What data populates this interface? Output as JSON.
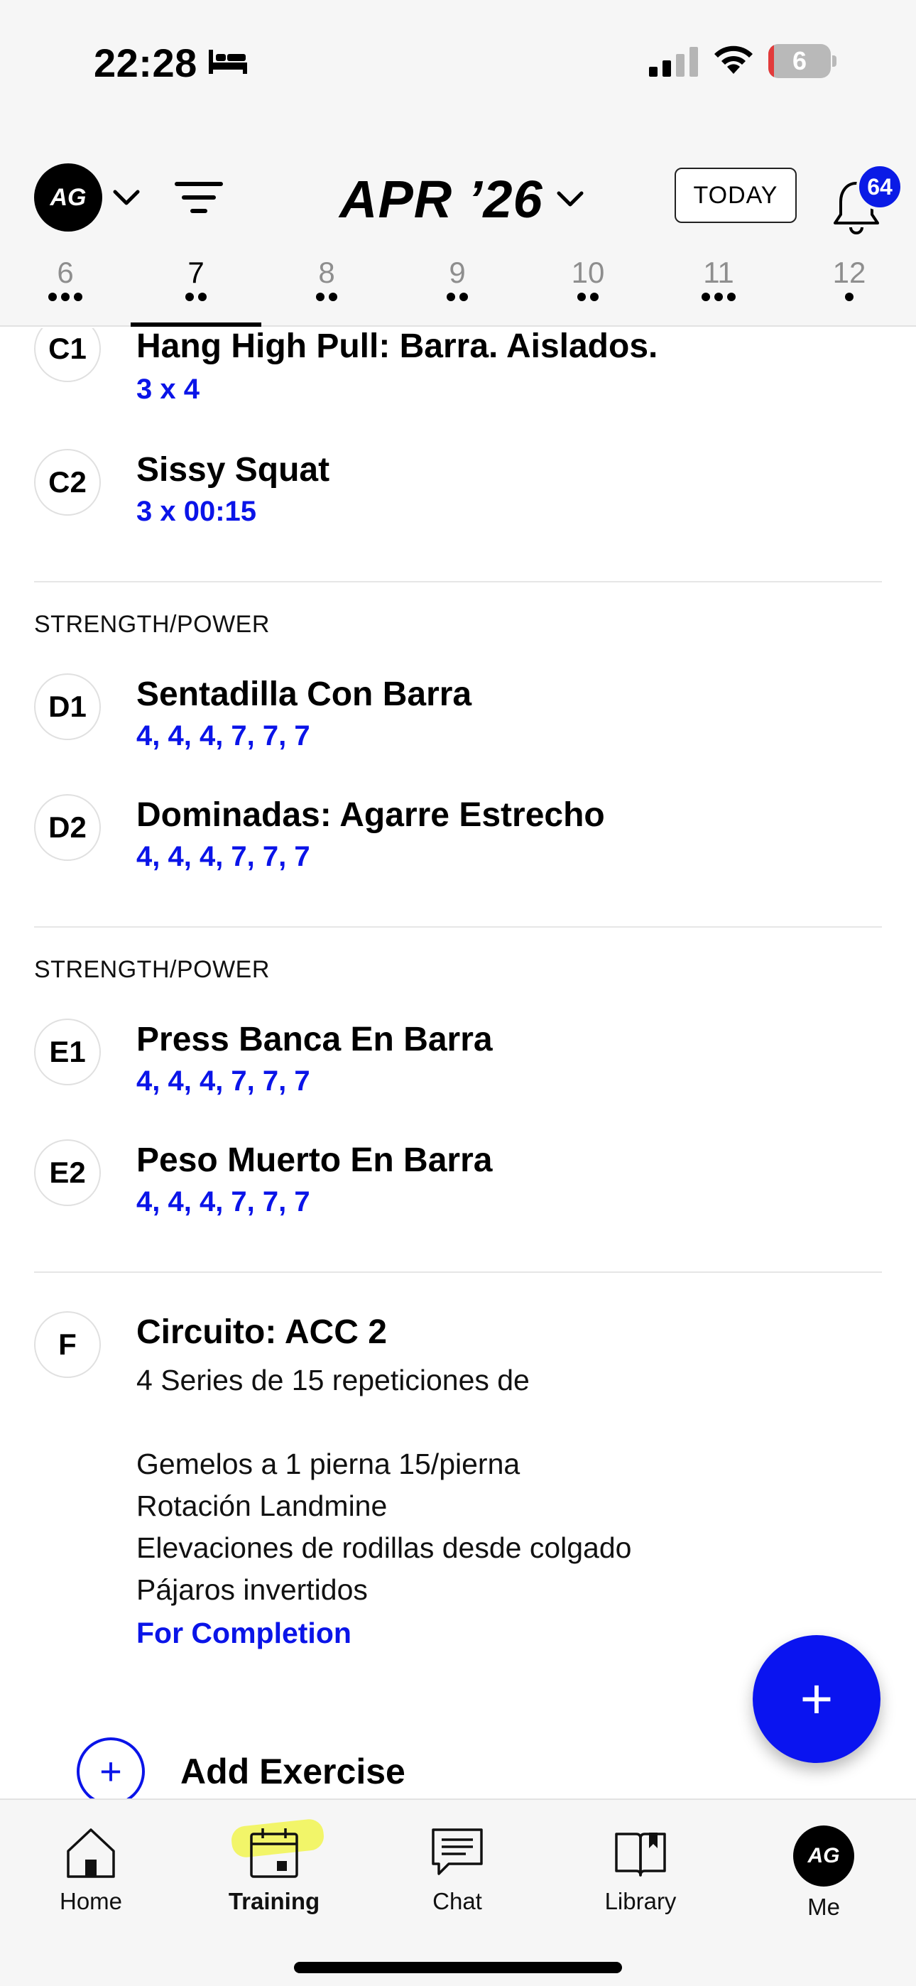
{
  "status_bar": {
    "time": "22:28",
    "battery_level": "6",
    "icons": [
      "bed-icon",
      "signal-icon",
      "wifi-icon",
      "battery-icon"
    ]
  },
  "header": {
    "avatar_initials": "AG",
    "month": "APR ’26",
    "today_label": "TODAY",
    "notification_count": "64",
    "icons": [
      "chevron-down-icon",
      "filter-icon",
      "bell-icon"
    ]
  },
  "days": [
    {
      "num": "6",
      "dots": 3
    },
    {
      "num": "7",
      "dots": 2,
      "active": true
    },
    {
      "num": "8",
      "dots": 2
    },
    {
      "num": "9",
      "dots": 2
    },
    {
      "num": "10",
      "dots": 2
    },
    {
      "num": "11",
      "dots": 3
    },
    {
      "num": "12",
      "dots": 1
    }
  ],
  "blocks": [
    {
      "exercises": [
        {
          "code": "C1",
          "name": "Hang High Pull: Barra. Aislados.",
          "sets": "3 x 4"
        },
        {
          "code": "C2",
          "name": "Sissy Squat",
          "sets": "3 x 00:15"
        }
      ]
    },
    {
      "label": "STRENGTH/POWER",
      "exercises": [
        {
          "code": "D1",
          "name": "Sentadilla Con Barra",
          "sets": "4, 4, 4, 7, 7, 7"
        },
        {
          "code": "D2",
          "name": "Dominadas: Agarre Estrecho",
          "sets": "4, 4, 4, 7, 7, 7"
        }
      ]
    },
    {
      "label": "STRENGTH/POWER",
      "exercises": [
        {
          "code": "E1",
          "name": "Press Banca En Barra",
          "sets": "4, 4, 4, 7, 7, 7"
        },
        {
          "code": "E2",
          "name": "Peso Muerto En Barra",
          "sets": "4, 4, 4, 7, 7, 7"
        }
      ]
    }
  ],
  "circuit": {
    "code": "F",
    "name": "Circuito: ACC 2",
    "description": "4 Series de 15 repeticiones de\n\nGemelos a 1 pierna 15/pierna\nRotación Landmine\nElevaciones de rodillas desde colgado\nPájaros invertidos",
    "completion": "For Completion"
  },
  "add_exercise": {
    "label": "Add Exercise",
    "icon": "plus-icon"
  },
  "fab": {
    "icon": "plus-icon"
  },
  "tabs": [
    {
      "label": "Home",
      "icon": "home-icon"
    },
    {
      "label": "Training",
      "icon": "calendar-icon",
      "active": true
    },
    {
      "label": "Chat",
      "icon": "chat-icon"
    },
    {
      "label": "Library",
      "icon": "book-icon"
    },
    {
      "label": "Me",
      "avatar": "AG"
    }
  ],
  "colors": {
    "accent": "#0a14e8",
    "header_bg": "#f6f6f6",
    "text": "#000000",
    "muted": "#8e8e8e",
    "highlight": "#f2f55a"
  }
}
